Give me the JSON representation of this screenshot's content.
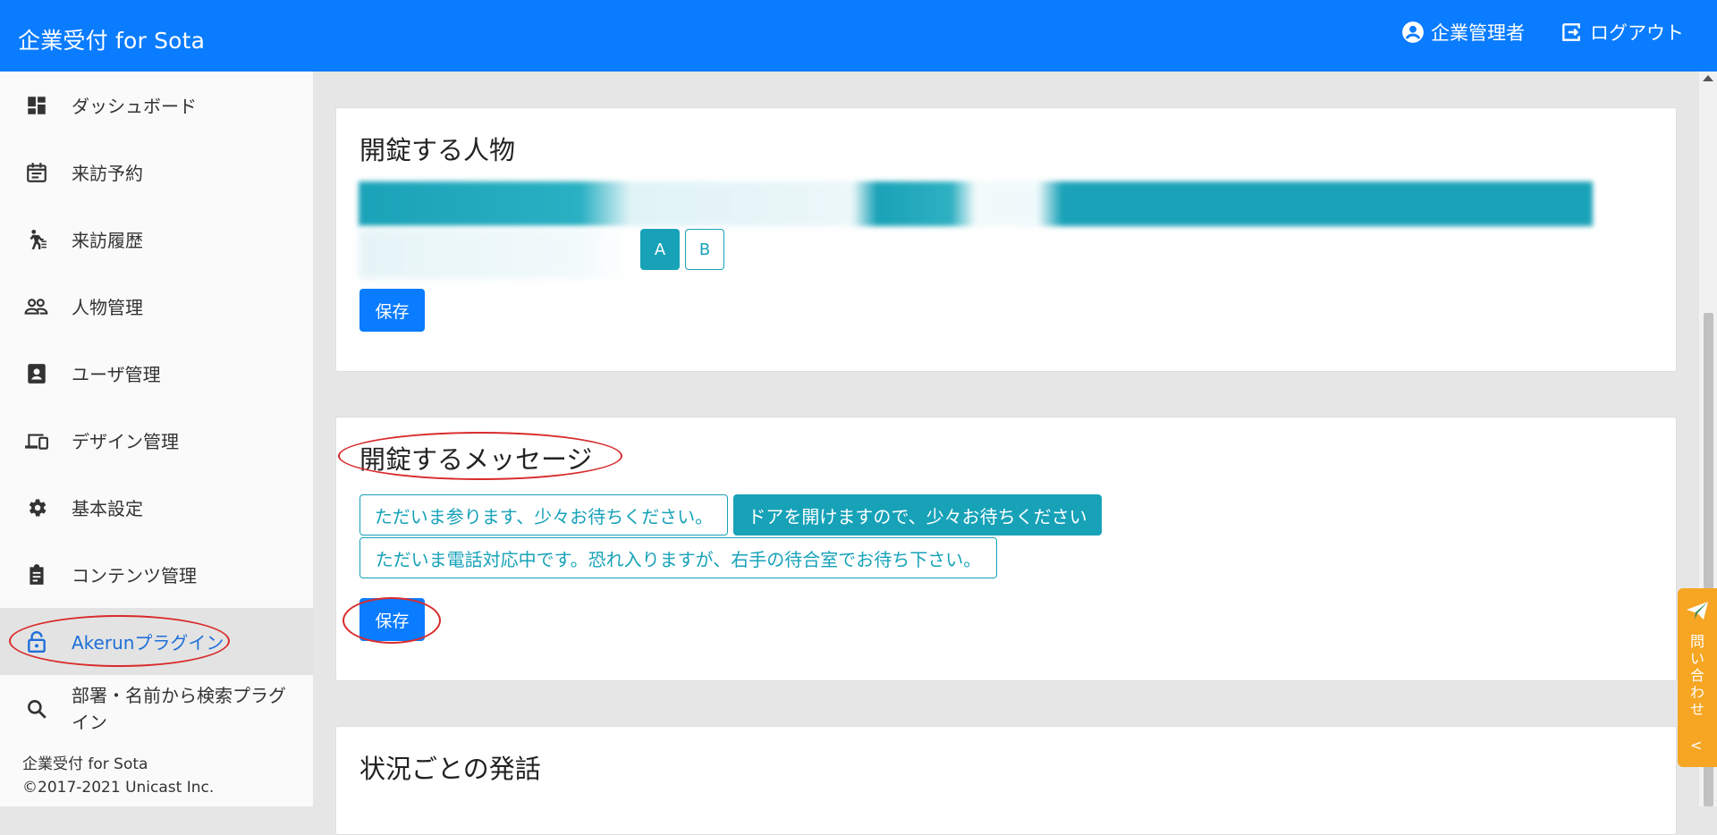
{
  "header": {
    "app_title": "企業受付 for Sota",
    "user_label": "企業管理者",
    "logout_label": "ログアウト"
  },
  "sidebar": {
    "items": [
      {
        "label": "ダッシュボード",
        "icon": "dashboard-icon"
      },
      {
        "label": "来訪予約",
        "icon": "calendar-icon"
      },
      {
        "label": "来訪履歴",
        "icon": "walking-person-icon"
      },
      {
        "label": "人物管理",
        "icon": "people-icon"
      },
      {
        "label": "ユーザ管理",
        "icon": "contact-card-icon"
      },
      {
        "label": "デザイン管理",
        "icon": "devices-icon"
      },
      {
        "label": "基本設定",
        "icon": "gear-icon"
      },
      {
        "label": "コンテンツ管理",
        "icon": "clipboard-icon"
      },
      {
        "label": "Akerunプラグイン",
        "icon": "lock-icon",
        "active": true
      },
      {
        "label": "部署・名前から検索プラグイン",
        "icon": "search-icon"
      }
    ],
    "footer_title": "企業受付 for Sota",
    "footer_copyright": "©2017-2021 Unicast Inc."
  },
  "main": {
    "card_person": {
      "title": "開錠する人物",
      "options": [
        "A",
        "B"
      ],
      "selected_option": "A",
      "save_label": "保存"
    },
    "card_message": {
      "title": "開錠するメッセージ",
      "messages": [
        "ただいま参ります、少々お待ちください。",
        "ドアを開けますので、少々お待ちください",
        "ただいま電話対応中です。恐れ入りますが、右手の待合室でお待ち下さい。"
      ],
      "selected_message": "ドアを開けますので、少々お待ちください",
      "save_label": "保存"
    },
    "card_speech": {
      "title": "状況ごとの発話"
    }
  },
  "contact_tab": {
    "label": "問い合わせ",
    "chevron": "<"
  },
  "colors": {
    "header_bg": "#0a7cff",
    "primary_button": "#0a7cff",
    "option_teal": "#17a2b8",
    "contact_tab": "#f6a623",
    "annotation_red": "#d92b2b"
  }
}
